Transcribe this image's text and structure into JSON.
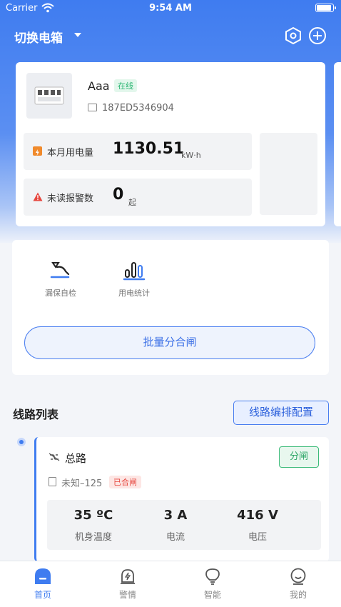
{
  "status_bar": {
    "carrier": "Carrier",
    "time": "9:54 AM"
  },
  "nav": {
    "title": "切换电箱"
  },
  "device": {
    "name": "Aaa",
    "status_badge": "在线",
    "serial": "187ED5346904",
    "monthly_usage": {
      "label": "本月用电量",
      "value": "1130.51",
      "unit": "kW·h"
    },
    "unread_alarms": {
      "label": "未读报警数",
      "value": "0",
      "unit": "起"
    }
  },
  "tools": {
    "items": [
      {
        "label": "漏保自检",
        "icon": "leak-test-icon"
      },
      {
        "label": "用电统计",
        "icon": "statistics-icon"
      }
    ],
    "batch_button": "批量分合闸"
  },
  "circuit_list": {
    "title": "线路列表",
    "config_button": "线路编排配置",
    "circuits": [
      {
        "name": "总路",
        "action_button": "分闸",
        "model": "未知–125",
        "state_badge": "已合闸",
        "metrics": [
          {
            "value": "35 ºC",
            "label": "机身温度"
          },
          {
            "value": "3 A",
            "label": "电流"
          },
          {
            "value": "416 V",
            "label": "电压"
          }
        ]
      }
    ]
  },
  "tab_bar": {
    "tabs": [
      {
        "label": "首页",
        "icon": "home-icon",
        "active": true
      },
      {
        "label": "警情",
        "icon": "alarm-icon",
        "active": false
      },
      {
        "label": "智能",
        "icon": "bulb-icon",
        "active": false
      },
      {
        "label": "我的",
        "icon": "profile-icon",
        "active": false
      }
    ]
  },
  "colors": {
    "primary": "#3f7cf0",
    "online": "#2bb673",
    "closed": "#e6453d",
    "open_button": "#2aa565"
  }
}
